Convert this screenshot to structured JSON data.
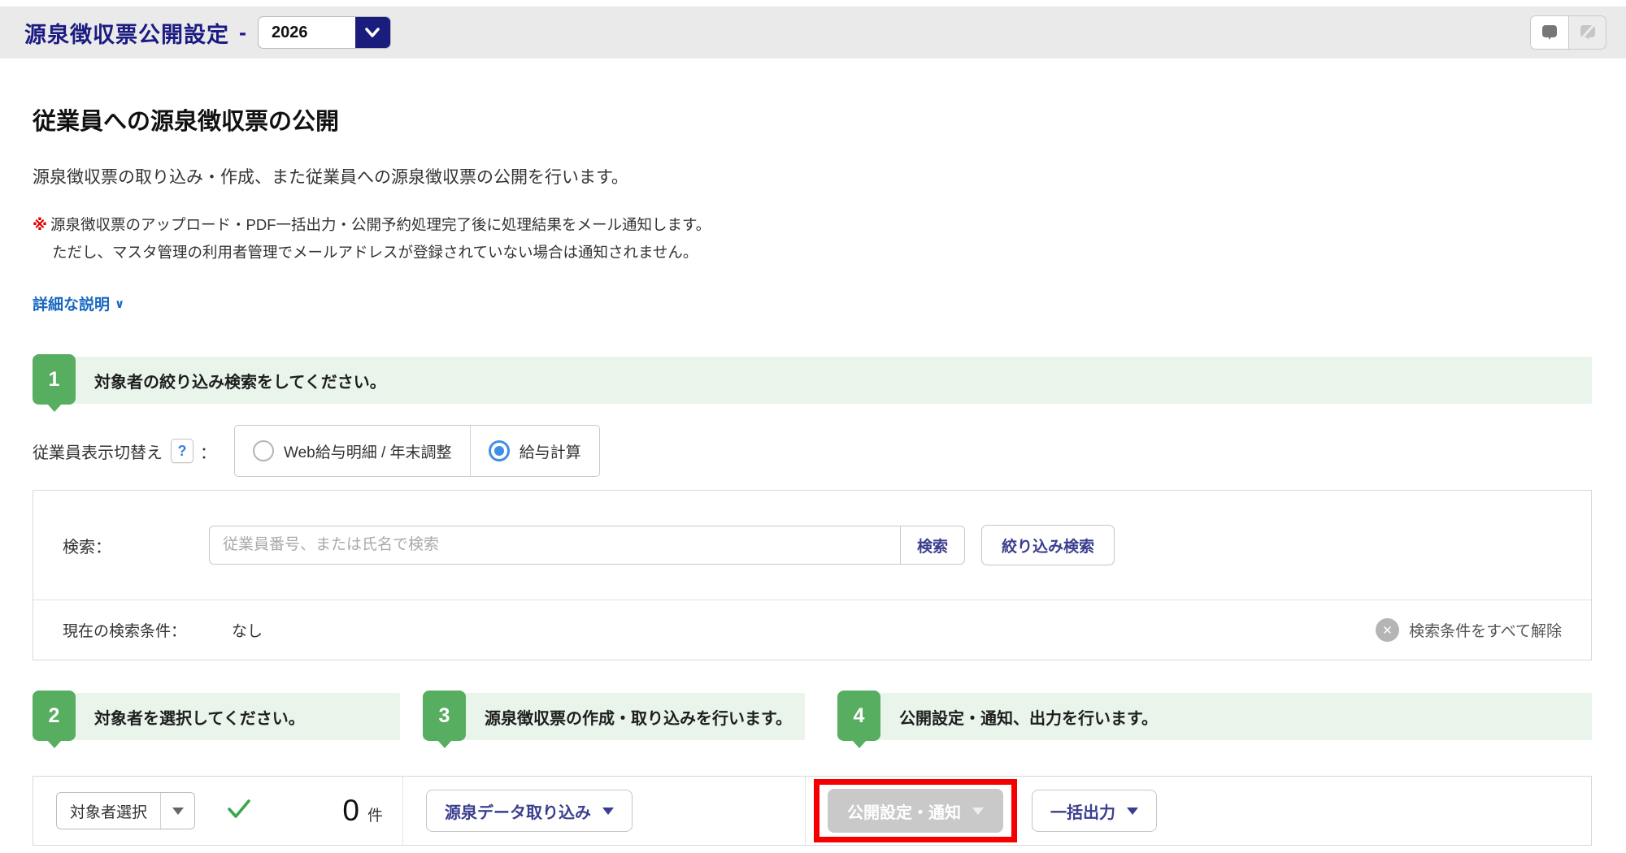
{
  "header": {
    "title": "源泉徴収票公開設定",
    "dash": "-",
    "year_select": {
      "value": "2026"
    }
  },
  "intro": {
    "heading": "従業員への源泉徴収票の公開",
    "description": "源泉徴収票の取り込み・作成、また従業員への源泉徴収票の公開を行います。",
    "note_mark": "※",
    "note_line1": "源泉徴収票のアップロード・PDF一括出力・公開予約処理完了後に処理結果をメール通知します。",
    "note_line2": "ただし、マスタ管理の利用者管理でメールアドレスが登録されていない場合は通知されません。",
    "details_link": "詳細な説明",
    "details_chevron": "∨"
  },
  "steps": {
    "step1": {
      "number": "1",
      "text": "対象者の絞り込み検索をしてください。"
    },
    "step2": {
      "number": "2",
      "text": "対象者を選択してください。"
    },
    "step3": {
      "number": "3",
      "text": "源泉徴収票の作成・取り込みを行います。"
    },
    "step4": {
      "number": "4",
      "text": "公開設定・通知、出力を行います。"
    }
  },
  "display_toggle": {
    "label": "従業員表示切替え",
    "help": "?",
    "colon": "：",
    "options": [
      {
        "label": "Web給与明細 / 年末調整",
        "selected": false
      },
      {
        "label": "給与計算",
        "selected": true
      }
    ]
  },
  "search": {
    "label": "検索：",
    "placeholder": "従業員番号、または氏名で検索",
    "search_button": "検索",
    "filter_button": "絞り込み検索",
    "current_label": "現在の検索条件：",
    "current_value": "なし",
    "clear_x": "✕",
    "clear_all": "検索条件をすべて解除"
  },
  "toolbar": {
    "select_target_button": "対象者選択",
    "count_value": "0",
    "count_unit": "件",
    "import_button": "源泉データ取り込み",
    "publish_button": "公開設定・通知",
    "export_button": "一括出力"
  },
  "colors": {
    "navy_title": "#1b1b82",
    "navy_button_text": "#3b3e8f",
    "green_badge": "#57ad60",
    "green_banner_bg": "#e9f4eb",
    "link_blue": "#1767c0",
    "radio_blue": "#3f8fe8",
    "disabled_gray": "#c9c9c9",
    "highlight_red": "#f50000",
    "header_bg": "#eaeaea",
    "check_green": "#3aa64a"
  }
}
